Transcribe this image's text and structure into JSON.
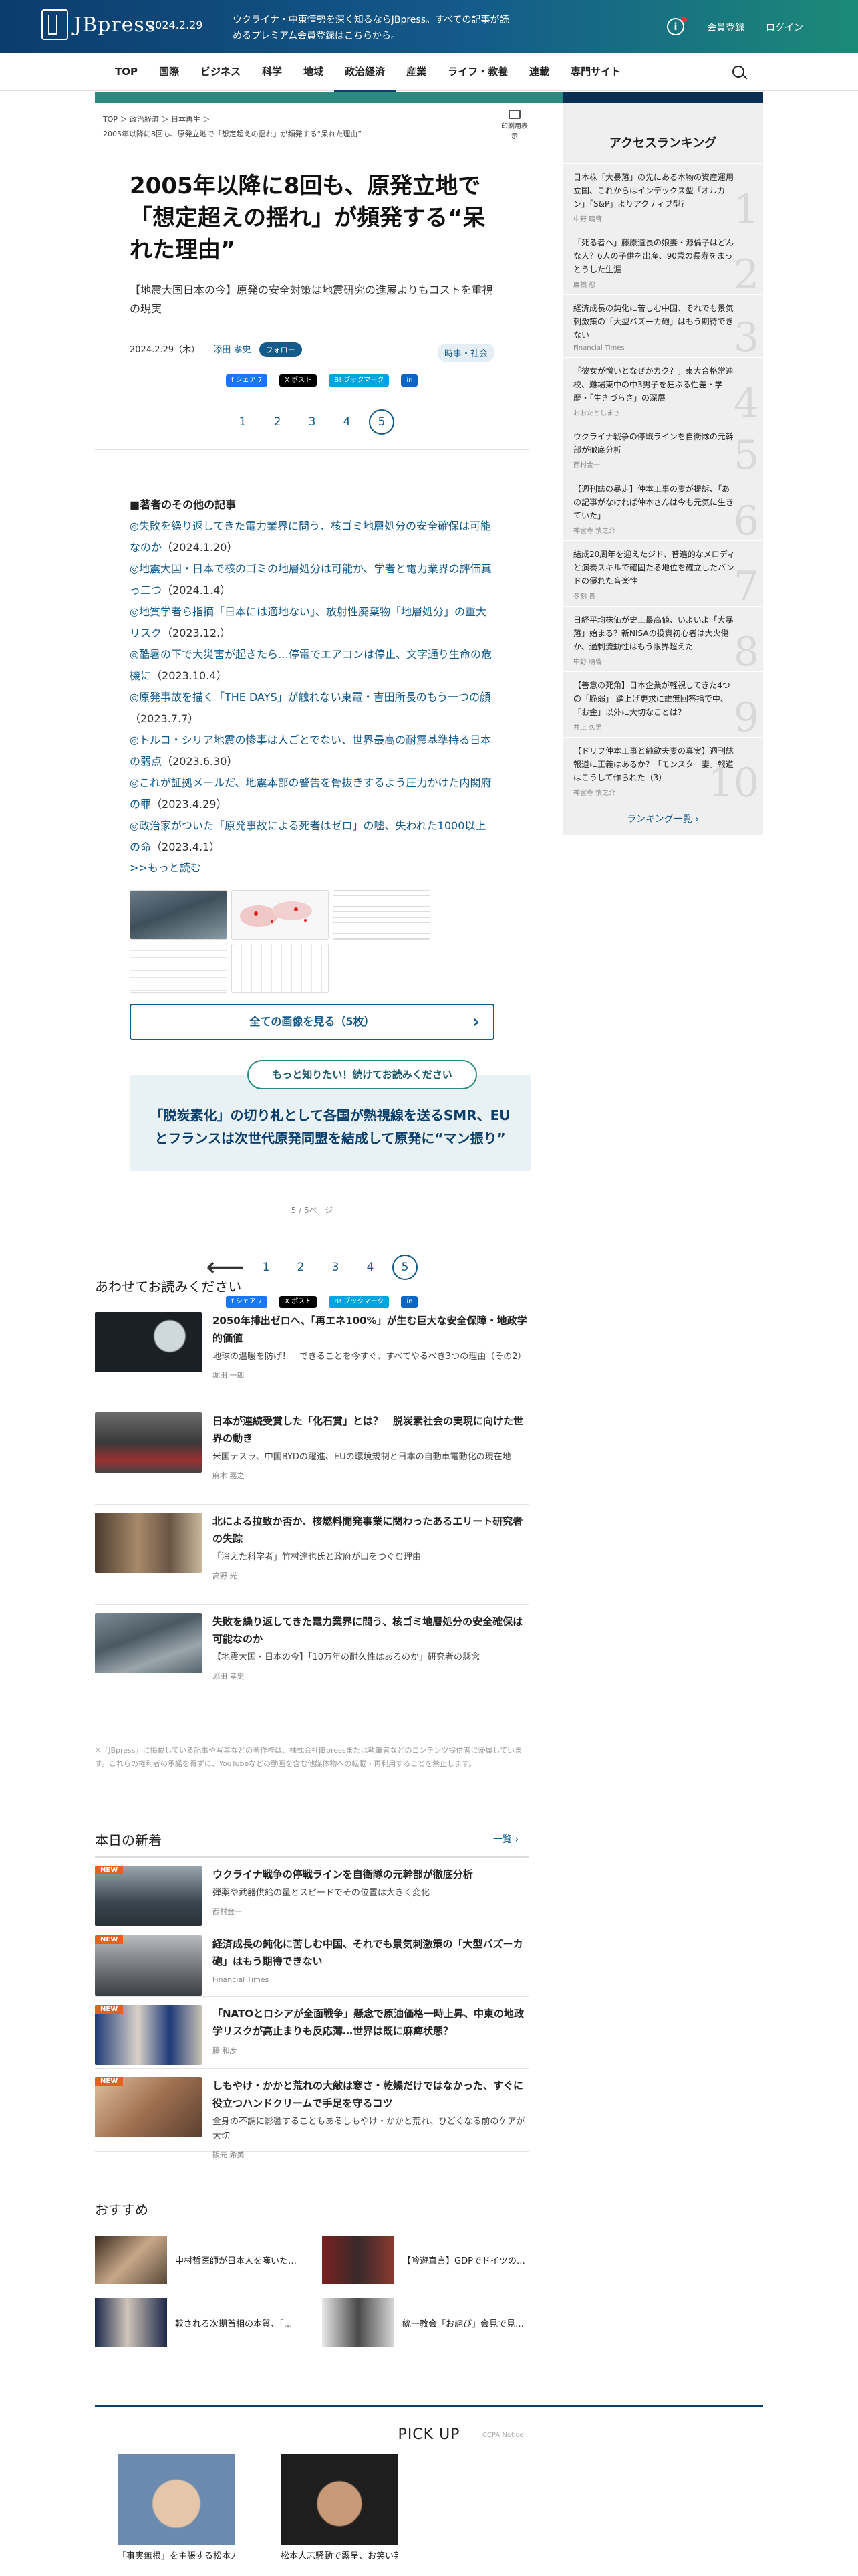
{
  "header": {
    "logo": "JBpress",
    "date": "2024.2.29",
    "promo": "ウクライナ・中東情勢を深く知るならJBpress。すべての記事が読めるプレミアム会員登録はこちらから。",
    "register": "会員登録",
    "login": "ログイン",
    "accent": "#145a8a"
  },
  "nav": {
    "items": [
      "TOP",
      "国際",
      "ビジネス",
      "科学",
      "地域",
      "政治経済",
      "産業",
      "ライフ・教養",
      "連載",
      "専門サイト"
    ],
    "active": "政治経済"
  },
  "breadcrumb": {
    "line1": "TOP ＞ 政治経済 ＞ 日本再生 ＞",
    "line2": "2005年以降に8回も、原発立地で「想定超えの揺れ」が頻発する“呆れた理由”",
    "print": "印刷用表示"
  },
  "article": {
    "title": "2005年以降に8回も、原発立地で「想定超えの揺れ」が頻発する“呆れた理由”",
    "subtitle": "【地震大国日本の今】原発の安全対策は地震研究の進展よりもコストを重視の現実",
    "date": "2024.2.29（木）",
    "author": "添田 孝史",
    "follow": "フォロー",
    "category": "時事・社会",
    "share": {
      "fb": "f シェア 7",
      "x": "X ポスト",
      "hb": "B! ブックマーク",
      "li": "in"
    },
    "pages": [
      "1",
      "2",
      "3",
      "4",
      "5"
    ],
    "current_page": "5",
    "related_title": "■著者のその他の記事",
    "related": [
      {
        "t": "◎失敗を繰り返してきた電力業界に問う、核ゴミ地層処分の安全確保は可能なのか",
        "d": "（2024.1.20）"
      },
      {
        "t": "◎地震大国・日本で核のゴミの地層処分は可能か、学者と電力業界の評価真っ二つ",
        "d": "（2024.1.4）"
      },
      {
        "t": "◎地質学者ら指摘「日本には適地ない」、放射性廃棄物「地層処分」の重大リスク",
        "d": "（2023.12.）"
      },
      {
        "t": "◎酷暑の下で大災害が起きたら…停電でエアコンは停止、文字通り生命の危機に",
        "d": "（2023.10.4）"
      },
      {
        "t": "◎原発事故を描く「THE DAYS」が触れない東電・吉田所長のもう一つの顔",
        "d": "（2023.7.7）"
      },
      {
        "t": "◎トルコ・シリア地震の惨事は人ごとでない、世界最高の耐震基準持る日本の弱点",
        "d": "（2023.6.30）"
      },
      {
        "t": "◎これが証拠メールだ、地震本部の警告を骨抜きするよう圧力かけた内閣府の罪",
        "d": "（2023.4.29）"
      },
      {
        "t": "◎政治家がついた「原発事故による死者はゼロ」の嘘、失われた1000以上の命",
        "d": "（2023.4.1）"
      }
    ],
    "more": ">>もっと読む",
    "view_all": "全ての画像を見る（5枚）",
    "read_more_pill": "もっと知りたい！続けてお読みください",
    "read_more_title": "「脱炭素化」の切り札として各国が熱視線を送るSMR、EUとフランスは次世代原発同盟を結成して原発に“マン振り”",
    "page_indicator": "5 / 5ページ",
    "back_arrow": "⟵"
  },
  "ranking": {
    "title": "アクセスランキング",
    "items": [
      {
        "t": "日本株「大暴落」の先にある本物の資産運用立国、これからはインデックス型「オルカン」「S&P」よりアクティブ型？",
        "a": "中野 晴啓"
      },
      {
        "t": "「死る者へ」藤原道長の娘妻・源倫子はどんな人？6人の子供を出産、90歳の長寿をまっとうした生涯",
        "a": "鷹橋 忍"
      },
      {
        "t": "経済成長の鈍化に苦しむ中国、それでも景気刺激策の「大型バズーカ砲」はもう期待できない",
        "a": "Financial Times"
      },
      {
        "t": "「彼女が憎いとなぜかカク？」東大合格常連校、難場東中の中3男子を狂ぶる性差・学歴・「生きづらさ」の深層",
        "a": "おおたとしまさ"
      },
      {
        "t": "ウクライナ戦争の停戦ラインを自衛隊の元幹部が徹底分析",
        "a": "西村金一"
      },
      {
        "t": "【週刊誌の暴走】仲本工事の妻が提訴、「あの記事がなければ仲本さんは今も元気に生きていた」",
        "a": "神宮寺 慎之介"
      },
      {
        "t": "結成20周年を迎えたジド、普遍的なメロディと演奏スキルで確固たる地位を確立したバンドの優れた音楽性",
        "a": "冬刻 貴"
      },
      {
        "t": "日経平均株価が史上最高値、いよいよ「大暴落」始まる？新NISAの投資初心者は大火傷か、過剰流動性はもう限界超えた",
        "a": "中野 晴啓"
      },
      {
        "t": "【善意の死角】日本企業が軽視してきた4つの「脆弱」 踏上げ更求に誰無回答指で中、「お金」以外に大切なことは？",
        "a": "井上 久男"
      },
      {
        "t": "【ドリフ仲本工事と純欲夫妻の真実】週刊誌報道に正義はあるか？「モンスター妻」報道はこうして作られた（3）",
        "a": "神宮寺 慎之介"
      }
    ],
    "list_link": "ランキング一覧 ›"
  },
  "related_section": {
    "title": "あわせてお読みください",
    "items": [
      {
        "t": "2050年排出ゼロへ、「再エネ100%」が生む巨大な安全保障・地政学的価値",
        "d": "地球の温暖を防げ！　できることを今すぐ、すべてやるべき3つの理由（その2）",
        "a": "堀田 一郎"
      },
      {
        "t": "日本が連続受賞した「化石賞」とは？　脱炭素社会の実現に向けた世界の動き",
        "d": "米国テスラ、中国BYDの躍進、EUの環境規制と日本の自動車電動化の現在地",
        "a": "麻木 嘉之"
      },
      {
        "t": "北による拉致か否か、核燃料開発事業に関わったあるエリート研究者の失踪",
        "d": "「消えた科学者」竹村達也氏と政府が口をつぐむ理由",
        "a": "高野 光"
      },
      {
        "t": "失敗を繰り返してきた電力業界に問う、核ゴミ地層処分の安全確保は可能なのか",
        "d": "【地震大国・日本の今】「10万年の耐久性はあるのか」研究者の懸念",
        "a": "添田 孝史"
      }
    ]
  },
  "notice": "※「JBpress」に掲載している記事や写真などの著作権は、株式会社JBpressまたは執筆者などのコンテンツ提供者に帰属しています。これらの権利者の承諾を得ずに、YouTubeなどの動画を含む他媒体物への転載・再利用することを禁止します。",
  "new_section": {
    "title": "本日の新着",
    "more": "一覧 ›",
    "badge": "NEW",
    "items": [
      {
        "t": "ウクライナ戦争の停戦ラインを自衛隊の元幹部が徹底分析",
        "d": "弾薬や武器供給の量とスピードでその位置は大きく変化",
        "a": "西村金一"
      },
      {
        "t": "経済成長の鈍化に苦しむ中国、それでも景気刺激策の「大型バズーカ砲」はもう期待できない",
        "d": "",
        "a": "Financial Times"
      },
      {
        "t": "「NATOとロシアが全面戦争」懸念で原油価格一時上昇、中東の地政学リスクが高止まりも反応薄…世界は既に麻痺状態？",
        "d": "",
        "a": "藤 和彦"
      },
      {
        "t": "しもやけ・かかと荒れの大敵は寒さ・乾燥だけではなかった、すぐに役立つハンドクリームで手足を守るコツ",
        "d": "全身の不調に影響することもあるしもやけ・かかと荒れ、ひどくなる前のケアが大切",
        "a": "阪元 希美"
      }
    ]
  },
  "osusume": {
    "title": "おすすめ",
    "items": [
      "中村哲医師が日本人を嘆いた…",
      "【吟遊直言】GDPでドイツの…",
      "較される次期首相の本質、「…",
      "統一教会「お詫び」会見で見…"
    ]
  },
  "pickup": {
    "title": "PICK UP",
    "sponsor": "CCPA Notice",
    "items": [
      "「事実無根」を主張する松本人志…",
      "松本人志騒動で露呈、お笑い芸人…"
    ]
  }
}
